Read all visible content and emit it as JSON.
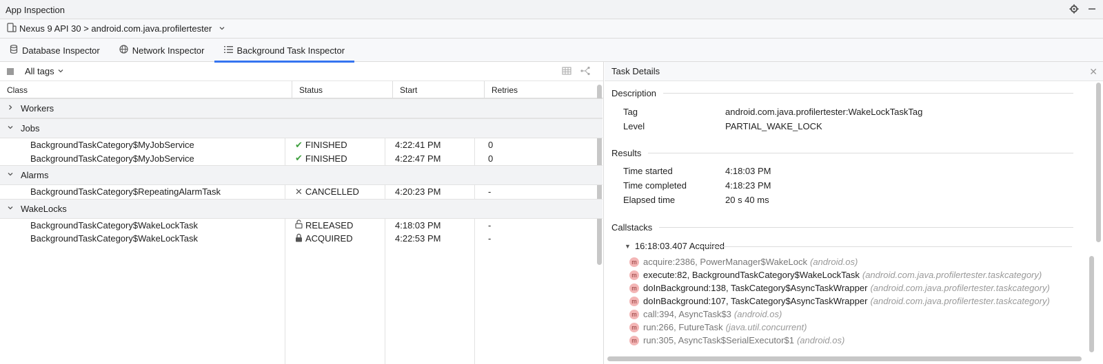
{
  "window": {
    "title": "App Inspection"
  },
  "device": {
    "label": "Nexus 9 API 30 > android.com.java.profilertester"
  },
  "tabs": [
    {
      "label": "Database Inspector",
      "icon": "database-icon"
    },
    {
      "label": "Network Inspector",
      "icon": "globe-icon"
    },
    {
      "label": "Background Task Inspector",
      "icon": "list-icon",
      "active": true
    }
  ],
  "toolbar": {
    "tags_label": "All tags"
  },
  "table": {
    "columns": [
      "Class",
      "Status",
      "Start",
      "Retries"
    ],
    "groups": [
      {
        "label": "Workers",
        "expanded": false,
        "rows": []
      },
      {
        "label": "Jobs",
        "expanded": true,
        "rows": [
          {
            "class": "BackgroundTaskCategory$MyJobService",
            "status": "FINISHED",
            "status_icon": "check-icon",
            "start": "4:22:41 PM",
            "retries": "0"
          },
          {
            "class": "BackgroundTaskCategory$MyJobService",
            "status": "FINISHED",
            "status_icon": "check-icon",
            "start": "4:22:47 PM",
            "retries": "0"
          }
        ]
      },
      {
        "label": "Alarms",
        "expanded": true,
        "rows": [
          {
            "class": "BackgroundTaskCategory$RepeatingAlarmTask",
            "status": "CANCELLED",
            "status_icon": "cross-icon",
            "start": "4:20:23 PM",
            "retries": "-"
          }
        ]
      },
      {
        "label": "WakeLocks",
        "expanded": true,
        "rows": [
          {
            "class": "BackgroundTaskCategory$WakeLockTask",
            "status": "RELEASED",
            "status_icon": "unlock-icon",
            "start": "4:18:03 PM",
            "retries": "-"
          },
          {
            "class": "BackgroundTaskCategory$WakeLockTask",
            "status": "ACQUIRED",
            "status_icon": "lock-icon",
            "start": "4:22:53 PM",
            "retries": "-"
          }
        ]
      }
    ]
  },
  "details": {
    "title": "Task Details",
    "description": {
      "label": "Description",
      "tag_key": "Tag",
      "tag_value": "android.com.java.profilertester:WakeLockTaskTag",
      "level_key": "Level",
      "level_value": "PARTIAL_WAKE_LOCK"
    },
    "results": {
      "label": "Results",
      "started_key": "Time started",
      "started_value": "4:18:03 PM",
      "completed_key": "Time completed",
      "completed_value": "4:18:23 PM",
      "elapsed_key": "Elapsed time",
      "elapsed_value": "20 s 40 ms"
    },
    "callstacks": {
      "label": "Callstacks",
      "entry": "16:18:03.407 Acquired",
      "frames": [
        {
          "fn": "acquire:2386, PowerManager$WakeLock",
          "pkg": "(android.os)",
          "dim": true
        },
        {
          "fn": "execute:82, BackgroundTaskCategory$WakeLockTask",
          "pkg": "(android.com.java.profilertester.taskcategory)",
          "dim": false
        },
        {
          "fn": "doInBackground:138, TaskCategory$AsyncTaskWrapper",
          "pkg": "(android.com.java.profilertester.taskcategory)",
          "dim": false
        },
        {
          "fn": "doInBackground:107, TaskCategory$AsyncTaskWrapper",
          "pkg": "(android.com.java.profilertester.taskcategory)",
          "dim": false
        },
        {
          "fn": "call:394, AsyncTask$3",
          "pkg": "(android.os)",
          "dim": true
        },
        {
          "fn": "run:266, FutureTask",
          "pkg": "(java.util.concurrent)",
          "dim": true
        },
        {
          "fn": "run:305, AsyncTask$SerialExecutor$1",
          "pkg": "(android.os)",
          "dim": true
        }
      ]
    }
  }
}
